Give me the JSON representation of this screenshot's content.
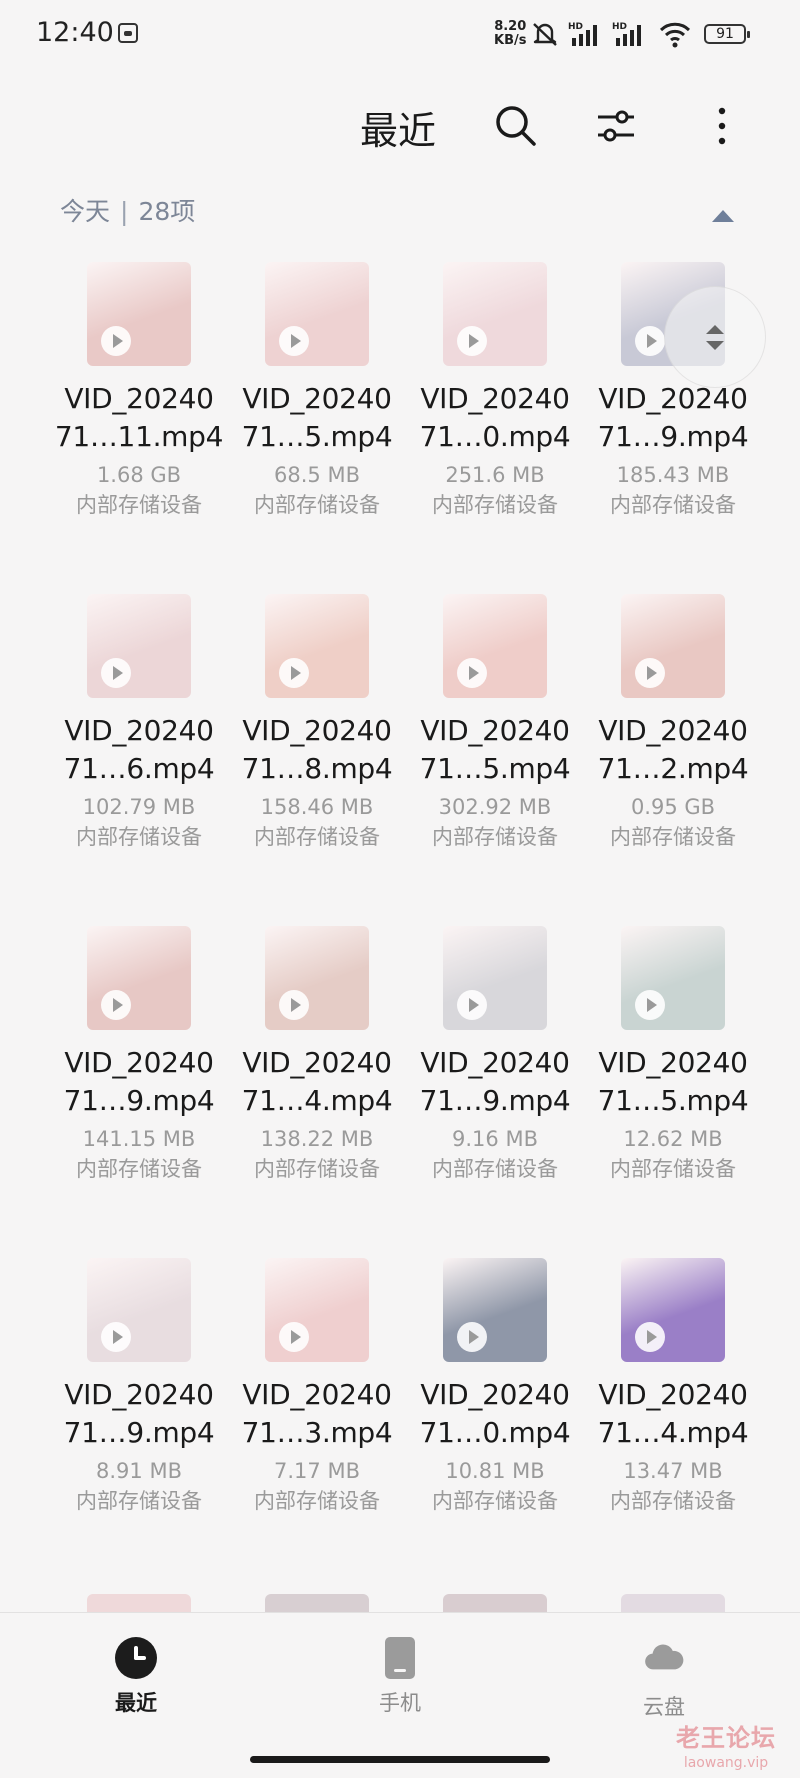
{
  "status_bar": {
    "time": "12:40",
    "net_speed_value": "8.20",
    "net_speed_unit": "KB/s",
    "signal1_label": "HD",
    "signal2_label": "HD",
    "battery": "91"
  },
  "app_bar": {
    "title": "最近",
    "search_icon": "search-icon",
    "filter_icon": "filter-sliders-icon",
    "more_icon": "more-vertical-icon"
  },
  "section": {
    "day": "今天",
    "separator": "|",
    "count": "28项"
  },
  "files": [
    {
      "name_line1": "VID_20240",
      "name_line2": "71…11.mp4",
      "size": "1.68 GB",
      "location": "内部存储设备",
      "thumb_color": "#e9c9c7"
    },
    {
      "name_line1": "VID_20240",
      "name_line2": "71…5.mp4",
      "size": "68.5 MB",
      "location": "内部存储设备",
      "thumb_color": "#eed2d2"
    },
    {
      "name_line1": "VID_20240",
      "name_line2": "71…0.mp4",
      "size": "251.6 MB",
      "location": "内部存储设备",
      "thumb_color": "#efd9dc"
    },
    {
      "name_line1": "VID_20240",
      "name_line2": "71…9.mp4",
      "size": "185.43 MB",
      "location": "内部存储设备",
      "thumb_color": "#c8c9d6"
    },
    {
      "name_line1": "VID_20240",
      "name_line2": "71…6.mp4",
      "size": "102.79 MB",
      "location": "内部存储设备",
      "thumb_color": "#ecd6d7"
    },
    {
      "name_line1": "VID_20240",
      "name_line2": "71…8.mp4",
      "size": "158.46 MB",
      "location": "内部存储设备",
      "thumb_color": "#efcfc7"
    },
    {
      "name_line1": "VID_20240",
      "name_line2": "71…5.mp4",
      "size": "302.92 MB",
      "location": "内部存储设备",
      "thumb_color": "#efcdc9"
    },
    {
      "name_line1": "VID_20240",
      "name_line2": "71…2.mp4",
      "size": "0.95 GB",
      "location": "内部存储设备",
      "thumb_color": "#e9c8c3"
    },
    {
      "name_line1": "VID_20240",
      "name_line2": "71…9.mp4",
      "size": "141.15 MB",
      "location": "内部存储设备",
      "thumb_color": "#e7c8c5"
    },
    {
      "name_line1": "VID_20240",
      "name_line2": "71…4.mp4",
      "size": "138.22 MB",
      "location": "内部存储设备",
      "thumb_color": "#e5ccc6"
    },
    {
      "name_line1": "VID_20240",
      "name_line2": "71…9.mp4",
      "size": "9.16 MB",
      "location": "内部存储设备",
      "thumb_color": "#d8d7db"
    },
    {
      "name_line1": "VID_20240",
      "name_line2": "71…5.mp4",
      "size": "12.62 MB",
      "location": "内部存储设备",
      "thumb_color": "#c9d4d2"
    },
    {
      "name_line1": "VID_20240",
      "name_line2": "71…9.mp4",
      "size": "8.91 MB",
      "location": "内部存储设备",
      "thumb_color": "#e8dde0"
    },
    {
      "name_line1": "VID_20240",
      "name_line2": "71…3.mp4",
      "size": "7.17 MB",
      "location": "内部存储设备",
      "thumb_color": "#efcfcf"
    },
    {
      "name_line1": "VID_20240",
      "name_line2": "71…0.mp4",
      "size": "10.81 MB",
      "location": "内部存储设备",
      "thumb_color": "#8f97a8"
    },
    {
      "name_line1": "VID_20240",
      "name_line2": "71…4.mp4",
      "size": "13.47 MB",
      "location": "内部存储设备",
      "thumb_color": "#9a7fc7"
    }
  ],
  "partial_row_colors": [
    "#efd9da",
    "#d8cfd2",
    "#d9cdd0",
    "#e3dbe2"
  ],
  "bottom_nav": {
    "items": [
      {
        "label": "最近",
        "icon": "clock-icon",
        "active": true
      },
      {
        "label": "手机",
        "icon": "phone-icon",
        "active": false
      },
      {
        "label": "云盘",
        "icon": "cloud-icon",
        "active": false
      }
    ]
  },
  "watermark": {
    "text_cn": "老王论坛",
    "text_en": "laowang.vip"
  },
  "colors": {
    "background": "#f6f5f5",
    "secondary_text": "#9a9a9a",
    "section_header": "#7d8697"
  }
}
